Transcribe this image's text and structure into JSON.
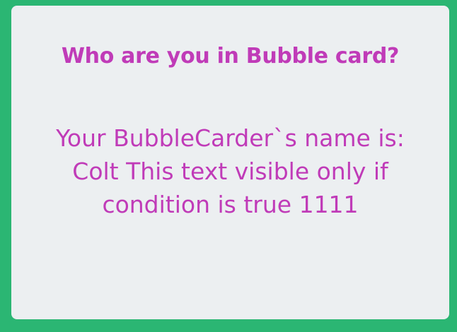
{
  "card": {
    "title": "Who are you in Bubble card?",
    "text": "Your BubbleCarder`s name is: Colt This text visible only if condition is true 1111"
  },
  "colors": {
    "page_background": "#2bb673",
    "card_background": "#eceff1",
    "text_color": "#c03bb8"
  }
}
